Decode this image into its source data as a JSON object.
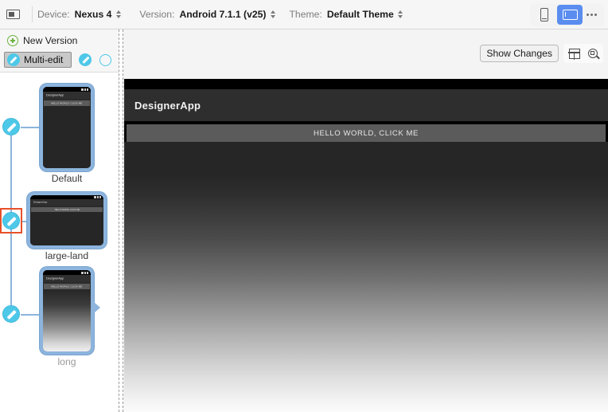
{
  "toolbar": {
    "display_icon": "display-icon",
    "device": {
      "label": "Device:",
      "value": "Nexus 4"
    },
    "version": {
      "label": "Version:",
      "value": "Android 7.1.1 (v25)"
    },
    "theme": {
      "label": "Theme:",
      "value": "Default Theme"
    },
    "orientation": {
      "portrait_icon": "phone-portrait-icon",
      "landscape_icon": "tablet-landscape-icon",
      "overflow_icon": "overflow-menu-icon",
      "selected": "landscape"
    }
  },
  "sidebar": {
    "new_version_label": "New Version",
    "new_version_icon": "plus-circle-icon",
    "multi_edit_label": "Multi-edit",
    "multi_edit_icon": "pencil-icon",
    "edit_icon": "pencil-icon",
    "empty_circle_icon": "circle-outline-icon",
    "versions": [
      {
        "label": "Default",
        "app_title": "DesignerApp",
        "button_label": "HELLO WORLD, CLICK ME",
        "orientation": "portrait",
        "selected": false,
        "gradient": false
      },
      {
        "label": "large-land",
        "app_title": "DesignerApp",
        "button_label": "HELLO WORLD, CLICK ME",
        "orientation": "landscape",
        "selected": true,
        "gradient": false
      },
      {
        "label": "long",
        "app_title": "DesignerApp",
        "button_label": "HELLO WORLD, CLICK ME",
        "orientation": "portrait",
        "selected": false,
        "gradient": true
      }
    ]
  },
  "preview": {
    "show_changes_label": "Show Changes",
    "split_icon": "split-layout-icon",
    "zoom_icon": "zoom-region-icon",
    "app_title": "DesignerApp",
    "button_label": "HELLO WORLD, CLICK ME"
  },
  "colors": {
    "accent_blue": "#5a8def",
    "node_cyan": "#4ec8e8",
    "edge_blue": "#8cb4dd",
    "selection_orange": "#e8502a",
    "plus_green": "#6cb33f"
  }
}
